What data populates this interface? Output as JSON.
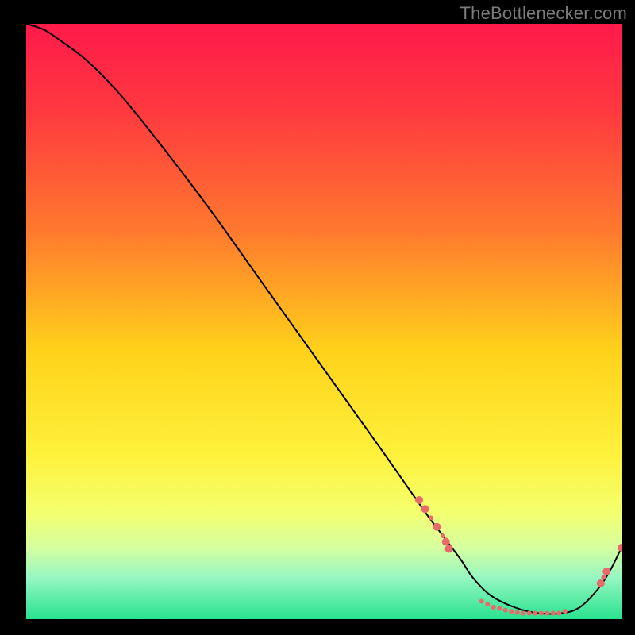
{
  "watermark": "TheBottlenecker.com",
  "chart_data": {
    "type": "line",
    "title": "",
    "xlabel": "",
    "ylabel": "",
    "xlim": [
      0,
      100
    ],
    "ylim": [
      0,
      100
    ],
    "grid": false,
    "legend": false,
    "background_gradient": {
      "stops": [
        {
          "pos": 0.0,
          "color": "#ff1a4b"
        },
        {
          "pos": 0.15,
          "color": "#ff3a3f"
        },
        {
          "pos": 0.35,
          "color": "#ff7a2e"
        },
        {
          "pos": 0.55,
          "color": "#ffd21a"
        },
        {
          "pos": 0.72,
          "color": "#fff13a"
        },
        {
          "pos": 0.82,
          "color": "#f4ff6e"
        },
        {
          "pos": 0.88,
          "color": "#d6ffa0"
        },
        {
          "pos": 0.93,
          "color": "#96f7c2"
        },
        {
          "pos": 1.0,
          "color": "#28e28f"
        }
      ]
    },
    "series": [
      {
        "name": "bottleneck-curve",
        "color": "#000000",
        "x": [
          0,
          3,
          6,
          10,
          15,
          20,
          30,
          40,
          50,
          60,
          67,
          70,
          73,
          75,
          78,
          82,
          86,
          90,
          93,
          96,
          98,
          100
        ],
        "y": [
          100,
          99,
          97,
          94,
          89,
          83,
          70,
          56,
          42,
          28,
          18,
          14,
          10,
          7,
          4,
          2,
          1,
          1,
          2,
          5,
          8,
          12
        ]
      }
    ],
    "markers": {
      "name": "highlight-dots",
      "color": "#e96a6a",
      "radius_small": 3.0,
      "radius_large": 5.0,
      "points": [
        {
          "x": 66.0,
          "y": 20.0,
          "r": "large"
        },
        {
          "x": 67.0,
          "y": 18.5,
          "r": "large"
        },
        {
          "x": 68.0,
          "y": 17.0,
          "r": "small"
        },
        {
          "x": 69.0,
          "y": 15.5,
          "r": "large"
        },
        {
          "x": 70.0,
          "y": 14.0,
          "r": "small"
        },
        {
          "x": 70.5,
          "y": 13.0,
          "r": "large"
        },
        {
          "x": 71.0,
          "y": 11.8,
          "r": "large"
        },
        {
          "x": 76.5,
          "y": 3.0,
          "r": "small"
        },
        {
          "x": 77.5,
          "y": 2.5,
          "r": "small"
        },
        {
          "x": 78.5,
          "y": 2.0,
          "r": "small"
        },
        {
          "x": 79.5,
          "y": 1.8,
          "r": "small"
        },
        {
          "x": 80.5,
          "y": 1.5,
          "r": "small"
        },
        {
          "x": 81.5,
          "y": 1.3,
          "r": "small"
        },
        {
          "x": 82.5,
          "y": 1.1,
          "r": "small"
        },
        {
          "x": 83.5,
          "y": 1.0,
          "r": "small"
        },
        {
          "x": 84.5,
          "y": 1.0,
          "r": "small"
        },
        {
          "x": 85.5,
          "y": 1.0,
          "r": "small"
        },
        {
          "x": 86.5,
          "y": 1.0,
          "r": "small"
        },
        {
          "x": 87.5,
          "y": 1.0,
          "r": "small"
        },
        {
          "x": 88.5,
          "y": 1.0,
          "r": "small"
        },
        {
          "x": 89.5,
          "y": 1.0,
          "r": "small"
        },
        {
          "x": 90.5,
          "y": 1.3,
          "r": "small"
        },
        {
          "x": 96.5,
          "y": 6.0,
          "r": "large"
        },
        {
          "x": 97.0,
          "y": 7.0,
          "r": "small"
        },
        {
          "x": 97.5,
          "y": 8.0,
          "r": "large"
        },
        {
          "x": 100.0,
          "y": 12.0,
          "r": "large"
        }
      ]
    }
  }
}
